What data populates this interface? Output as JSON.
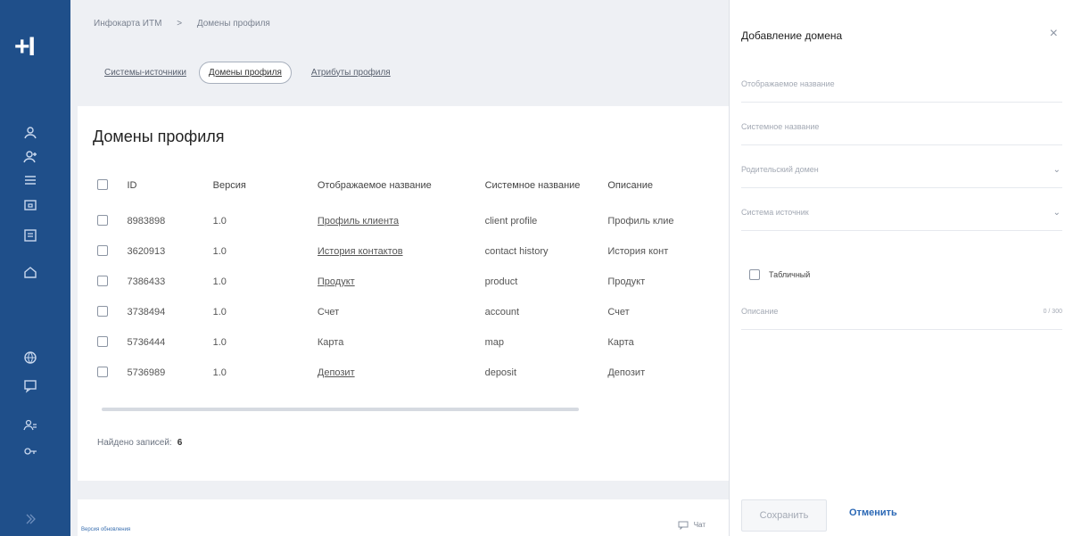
{
  "rail": {
    "logo": "+I",
    "icons": [
      "users-icon",
      "user-add-icon",
      "list-icon",
      "folder-icon",
      "document-icon",
      "home-icon",
      "globe-icon",
      "chat-icon",
      "group-icon",
      "key-icon",
      "expand-icon"
    ]
  },
  "breadcrumb": {
    "items": [
      "Инфокарта ИТМ",
      ">",
      "Домены профиля"
    ]
  },
  "tabs": [
    {
      "label": "Системы-источники"
    },
    {
      "label": "Домены профиля"
    },
    {
      "label": "Атрибуты профиля"
    }
  ],
  "page": {
    "title": "Домены профиля"
  },
  "table": {
    "headers": [
      "ID",
      "Версия",
      "Отображаемое название",
      "Системное название",
      "Описание"
    ],
    "rows": [
      {
        "id": "8983898",
        "version": "1.0",
        "display": "Профиль клиента",
        "system": "client profile",
        "desc": "Профиль клие"
      },
      {
        "id": "3620913",
        "version": "1.0",
        "display": "История контактов",
        "system": "contact history",
        "desc": "История конт"
      },
      {
        "id": "7386433",
        "version": "1.0",
        "display": "Продукт",
        "system": "product",
        "desc": "Продукт"
      },
      {
        "id": "3738494",
        "version": "1.0",
        "display": "Счет",
        "system": "account",
        "desc": "Счет"
      },
      {
        "id": "5736444",
        "version": "1.0",
        "display": "Карта",
        "system": "map",
        "desc": "Карта"
      },
      {
        "id": "5736989",
        "version": "1.0",
        "display": "Депозит",
        "system": "deposit",
        "desc": "Депозит"
      }
    ]
  },
  "found": {
    "label": "Найдено записей:",
    "count": "6"
  },
  "footer": {
    "link": "Версия обновления",
    "chat": "Чат"
  },
  "panel": {
    "title": "Добавление домена",
    "close": "×",
    "display_name_placeholder": "Отображаемое название",
    "system_name_placeholder": "Системное название",
    "parent_domain_placeholder": "Родительский домен",
    "source_system_placeholder": "Система источник",
    "tabular_label": "Табличный",
    "description_placeholder": "Описание",
    "description_counter": "0 / 300",
    "save_label": "Сохранить",
    "cancel_label": "Отменить"
  }
}
